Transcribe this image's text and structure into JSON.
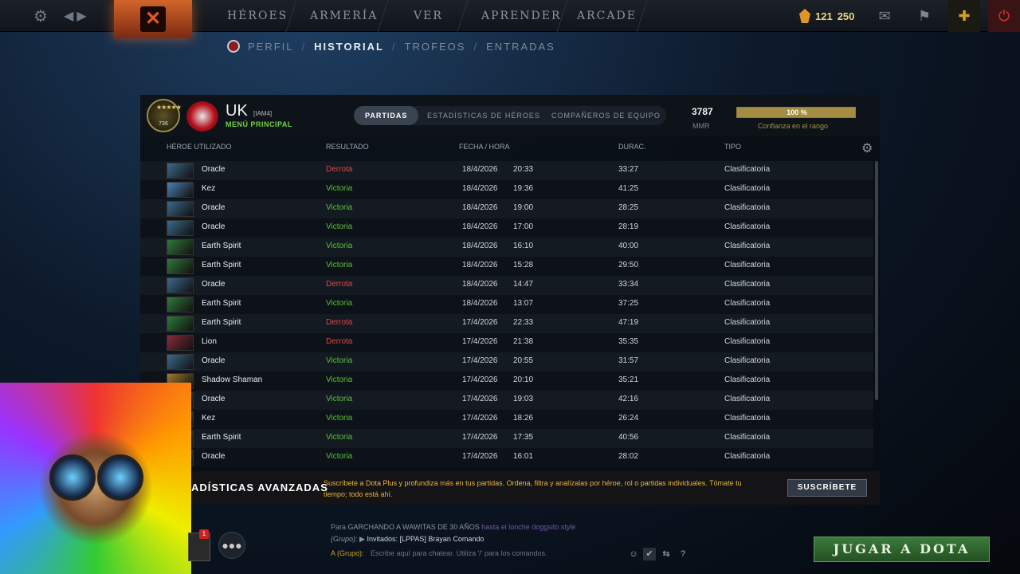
{
  "topnav": {
    "items": [
      "HÉROES",
      "ARMERÍA",
      "VER",
      "APRENDER",
      "ARCADE"
    ],
    "shards": "121",
    "points": "250"
  },
  "subnav": {
    "perfil": "PERFIL",
    "historial": "HISTORIAL",
    "trofeos": "TROFEOS",
    "entradas": "ENTRADAS",
    "sep": "/"
  },
  "profile": {
    "name": "UK",
    "tag": "[IAM4]",
    "menu": "MENÚ PRINCIPAL",
    "medal_number": "736",
    "mmr_value": "3787",
    "mmr_label": "MMR",
    "confidence_text": "100 %",
    "confidence_fraction": 1.0,
    "confidence_label": "Confianza en el rango"
  },
  "tabs": [
    "PARTIDAS",
    "ESTADÍSTICAS DE HÉROES",
    "COMPAÑEROS DE EQUIPO"
  ],
  "columns": {
    "hero": "HÉROE UTILIZADO",
    "result": "RESULTADO",
    "date": "FECHA / HORA",
    "duration": "DURAC.",
    "type": "TIPO"
  },
  "matches": [
    {
      "hero": "Oracle",
      "result": "Derrota",
      "win": false,
      "date": "18/4/2026",
      "time": "20:33",
      "dur": "33:27",
      "type": "Clasificatoria",
      "color": "#3a6a8a"
    },
    {
      "hero": "Kez",
      "result": "Victoria",
      "win": true,
      "date": "18/4/2026",
      "time": "19:36",
      "dur": "41:25",
      "type": "Clasificatoria",
      "color": "#4a7fb0"
    },
    {
      "hero": "Oracle",
      "result": "Victoria",
      "win": true,
      "date": "18/4/2026",
      "time": "19:00",
      "dur": "28:25",
      "type": "Clasificatoria",
      "color": "#3a6a8a"
    },
    {
      "hero": "Oracle",
      "result": "Victoria",
      "win": true,
      "date": "18/4/2026",
      "time": "17:00",
      "dur": "28:19",
      "type": "Clasificatoria",
      "color": "#3a6a8a"
    },
    {
      "hero": "Earth Spirit",
      "result": "Victoria",
      "win": true,
      "date": "18/4/2026",
      "time": "16:10",
      "dur": "40:00",
      "type": "Clasificatoria",
      "color": "#2f7a3a"
    },
    {
      "hero": "Earth Spirit",
      "result": "Victoria",
      "win": true,
      "date": "18/4/2026",
      "time": "15:28",
      "dur": "29:50",
      "type": "Clasificatoria",
      "color": "#2f7a3a"
    },
    {
      "hero": "Oracle",
      "result": "Derrota",
      "win": false,
      "date": "18/4/2026",
      "time": "14:47",
      "dur": "33:34",
      "type": "Clasificatoria",
      "color": "#3a6a8a"
    },
    {
      "hero": "Earth Spirit",
      "result": "Victoria",
      "win": true,
      "date": "18/4/2026",
      "time": "13:07",
      "dur": "37:25",
      "type": "Clasificatoria",
      "color": "#2f7a3a"
    },
    {
      "hero": "Earth Spirit",
      "result": "Derrota",
      "win": false,
      "date": "17/4/2026",
      "time": "22:33",
      "dur": "47:19",
      "type": "Clasificatoria",
      "color": "#2f7a3a"
    },
    {
      "hero": "Lion",
      "result": "Derrota",
      "win": false,
      "date": "17/4/2026",
      "time": "21:38",
      "dur": "35:35",
      "type": "Clasificatoria",
      "color": "#8a2a3a"
    },
    {
      "hero": "Oracle",
      "result": "Victoria",
      "win": true,
      "date": "17/4/2026",
      "time": "20:55",
      "dur": "31:57",
      "type": "Clasificatoria",
      "color": "#3a6a8a"
    },
    {
      "hero": "Shadow Shaman",
      "result": "Victoria",
      "win": true,
      "date": "17/4/2026",
      "time": "20:10",
      "dur": "35:21",
      "type": "Clasificatoria",
      "color": "#a07a30"
    },
    {
      "hero": "Oracle",
      "result": "Victoria",
      "win": true,
      "date": "17/4/2026",
      "time": "19:03",
      "dur": "42:16",
      "type": "Clasificatoria",
      "color": "#3a6a8a"
    },
    {
      "hero": "Kez",
      "result": "Victoria",
      "win": true,
      "date": "17/4/2026",
      "time": "18:26",
      "dur": "26:24",
      "type": "Clasificatoria",
      "color": "#4a7fb0"
    },
    {
      "hero": "Earth Spirit",
      "result": "Victoria",
      "win": true,
      "date": "17/4/2026",
      "time": "17:35",
      "dur": "40:56",
      "type": "Clasificatoria",
      "color": "#2f7a3a"
    },
    {
      "hero": "Oracle",
      "result": "Victoria",
      "win": true,
      "date": "17/4/2026",
      "time": "16:01",
      "dur": "28:02",
      "type": "Clasificatoria",
      "color": "#3a6a8a"
    }
  ],
  "promo": {
    "title": "ADÍSTICAS AVANZADAS",
    "text": "Suscríbete a Dota Plus y profundiza más en tus partidas. Ordena, filtra y analízalas por héroe, rol o partidas individuales. Tómate tu tiempo; todo está ahí.",
    "button": "SUSCRÍBETE"
  },
  "chat": {
    "line1_prefix": "Para",
    "line1_target": "GARCHANDO A WAWITAS DE 30 AÑOS",
    "line1_status": "hasta el lonche doggsito style",
    "line2_prefix": "(Grupo):",
    "line2_text": "Invitados: [LPPAS] Brayan Comando",
    "input_prefix": "A (Grupo):",
    "input_placeholder": "Escribe aquí para chatear. Utiliza '/' para los comandos.",
    "help": "?"
  },
  "party": {
    "badge": "1"
  },
  "play_button": "JUGAR A DOTA",
  "colors": {
    "win": "#58c13b",
    "loss": "#e04545",
    "accent": "#e8b63c"
  }
}
